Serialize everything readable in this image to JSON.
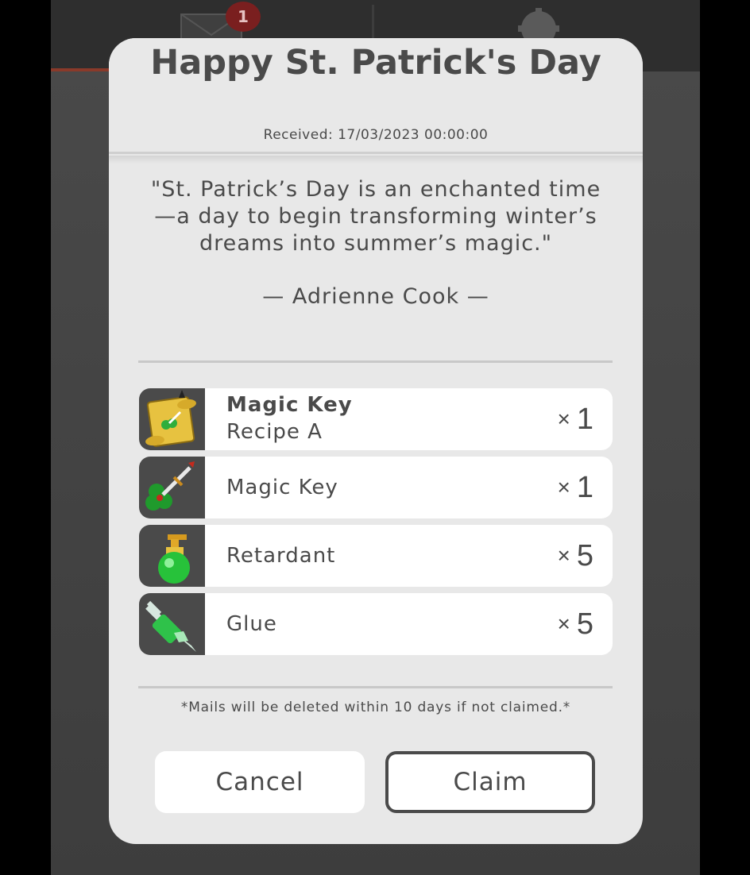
{
  "background": {
    "mail_badge_count": "1",
    "icons": [
      "mail-icon",
      "gear-icon"
    ]
  },
  "modal": {
    "title": "Happy St. Patrick's Day",
    "received": "Received: 17/03/2023 00:00:00",
    "quote": "\"St. Patrick’s Day is an enchanted time—a day to begin transforming winter’s dreams into summer’s magic.\"",
    "quote_author": "— Adrienne Cook —",
    "items": [
      {
        "name": "Magic Key",
        "subtitle": "Recipe A",
        "qty_prefix": "×",
        "qty": "1",
        "icon": "scroll-recipe-icon"
      },
      {
        "name": "Magic Key",
        "qty_prefix": "×",
        "qty": "1",
        "icon": "clover-key-icon"
      },
      {
        "name": "Retardant",
        "qty_prefix": "×",
        "qty": "5",
        "icon": "green-potion-icon"
      },
      {
        "name": "Glue",
        "qty_prefix": "×",
        "qty": "5",
        "icon": "glue-syringe-icon"
      }
    ],
    "notice": "*Mails will be deleted within 10 days if not claimed.*",
    "cancel_label": "Cancel",
    "claim_label": "Claim"
  },
  "colors": {
    "modal_bg": "#e8e8e8",
    "text": "#4a4a4a",
    "icon_bg": "#4a4a4a",
    "badge": "#7a1f1f"
  }
}
